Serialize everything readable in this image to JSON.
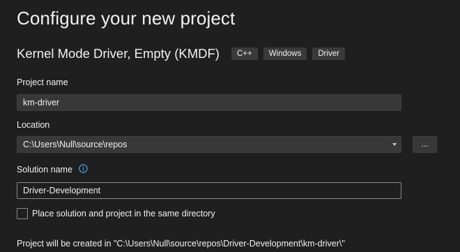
{
  "header": {
    "title": "Configure your new project"
  },
  "template": {
    "name": "Kernel Mode Driver, Empty (KMDF)",
    "tags": [
      "C++",
      "Windows",
      "Driver"
    ]
  },
  "project_name": {
    "label": "Project name",
    "value": "km-driver"
  },
  "location": {
    "label": "Location",
    "value": "C:\\Users\\Null\\source\\repos",
    "browse_label": "..."
  },
  "solution_name": {
    "label": "Solution name",
    "value": "Driver-Development",
    "info_icon": "info-icon"
  },
  "same_directory": {
    "label": "Place solution and project in the same directory",
    "checked": false
  },
  "footer": {
    "note": "Project will be created in \"C:\\Users\\Null\\source\\repos\\Driver-Development\\km-driver\\\""
  },
  "colors": {
    "background": "#1f1f1f",
    "field_background": "#383838",
    "tag_background": "#3a3a3a",
    "info_icon": "#4aa0e6",
    "text": "#f1f1f1"
  }
}
